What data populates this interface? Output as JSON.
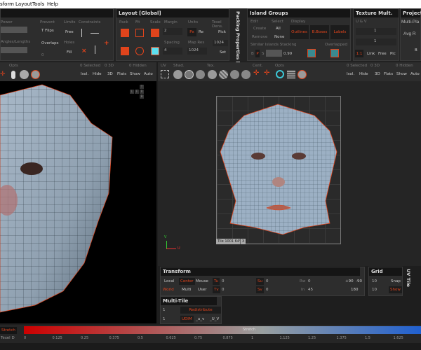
{
  "menu": [
    "sform",
    "Layout",
    "Tools",
    "Help"
  ],
  "unfold_panel": {
    "power_label": "Power",
    "angles_label": "Angles/Lengths",
    "prevent_label": "Prevent",
    "t_flips": "T Flips",
    "overlaps": "Overlaps",
    "overlaps_value": "0",
    "limits_label": "Limits",
    "free": "Free",
    "holes_label": "Holes",
    "fill": "Fill",
    "constraints_label": "Constraints"
  },
  "layout_panel": {
    "title": "Layout [Global]",
    "pack": "Pack",
    "fit": "Fit",
    "scale": "Scale",
    "margin_label": "Margin",
    "margin_value": "2",
    "spacing_label": "Spacing",
    "spacing_value": "4",
    "units_label": "Units",
    "unit_px": "Px",
    "unit_re": "Re",
    "map_res_label": "Map Res",
    "map_res_value": "1024",
    "texel_label": "Texel Dens.",
    "pick": "Pick",
    "texel_value": "1024",
    "set": "Set"
  },
  "packing_vertical": "Packing Properties [Glo",
  "island_groups": {
    "title": "Island Groups",
    "edit": "Edit",
    "create": "Create",
    "remove": "Remove",
    "select": "Select",
    "all": "All",
    "none": "None",
    "display": "Display",
    "outlines": "Outlines",
    "bboxes": "B.Boxes",
    "labels": "Labels",
    "stacking_label": "Similar Islands Stacking",
    "b": "B",
    "p": "P",
    "s": "S",
    "stack_value": "0.99",
    "overlapped": "Overlapped"
  },
  "texture_mult": {
    "title": "Texture Mult.",
    "uv_label": "U & V",
    "u_value": "1",
    "v_value": "1",
    "ratio": "1:1",
    "link": "Link",
    "free": "Free",
    "pic": "Pic"
  },
  "projection": {
    "title": "Projectio",
    "multi": "Multi-Pla",
    "avg": "Avg R",
    "b": "B"
  },
  "view3d_toolbar": {
    "opts": "Opts",
    "selected": "0 Selected",
    "three_d": "0 3D",
    "hidden": "0 Hidden",
    "isol": "Isol.",
    "hide": "Hide",
    "btn3d": "3D",
    "flats": "Flats",
    "show": "Show",
    "auto": "Auto"
  },
  "view_cube": [
    "T",
    "L",
    "F",
    "R",
    "B"
  ],
  "uv_toolbar": {
    "uv": "UV",
    "shad": "Shad.",
    "tex": "Tex.",
    "cent": "Cent.",
    "opts": "Opts",
    "selected": "0 Selected",
    "three_d": "0 3D",
    "hidden": "0 Hidden",
    "isol": "Isol.",
    "hide": "Hide",
    "btn3d": "3D",
    "flats": "Flats",
    "show": "Show",
    "auto": "Auto"
  },
  "uv_view": {
    "tile_label": "Tile 1001 64%",
    "tile_close": "X",
    "axis_u": "U",
    "axis_v": "V"
  },
  "transform": {
    "title": "Transform",
    "local": "Local",
    "center": "Center",
    "mouse": "Mouse",
    "world": "World",
    "multi": "Multi",
    "user": "User",
    "tu": "Tu",
    "tu_value": "0",
    "tv": "Tv",
    "tv_value": "0",
    "su": "Su",
    "su_value": "0",
    "sv": "Sv",
    "sv_value": "0",
    "rw": "Rw",
    "rw_value": "0",
    "in": "In",
    "in_value": "45",
    "rot_a": "+90",
    "rot_b": "-90",
    "rot_c": "180"
  },
  "grid": {
    "title": "Grid",
    "v1": "10",
    "v2": "10",
    "snap": "Snap",
    "show": "Show"
  },
  "uv_tile_vertical": "UV Tile",
  "multi_tile": {
    "title": "Multi-Tile",
    "v1": "1",
    "v2": "1",
    "redistribute": "Redistribute",
    "udim": "UDIM",
    "uv": "_u_v",
    "UV": "_U_V"
  },
  "stretch": {
    "tab": "Stretch",
    "texel": "Texel D",
    "bar_label": "Stretch",
    "ticks": [
      "0",
      "0.125",
      "0.25",
      "0.375",
      "0.5",
      "0.625",
      "0.75",
      "0.875",
      "1",
      "1.125",
      "1.25",
      "1.375",
      "1.5",
      "1.625",
      "1."
    ]
  },
  "colors": {
    "accent": "#e0441c",
    "bar_low": "#cc0000",
    "bar_mid": "#9aa0a0",
    "bar_high": "#2060d0"
  }
}
